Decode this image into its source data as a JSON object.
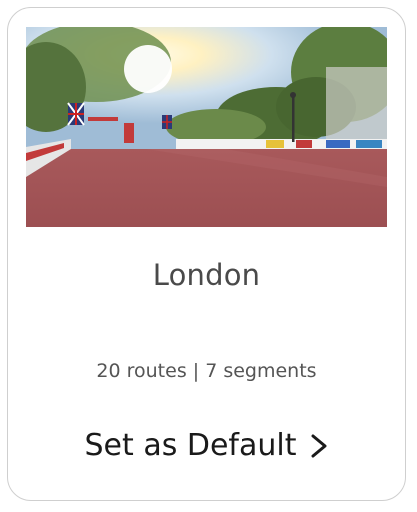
{
  "world": {
    "name": "London",
    "stats": "20 routes | 7 segments",
    "image_icon": "london-road-scene"
  },
  "action": {
    "label": "Set as Default",
    "icon": "chevron-right-icon"
  }
}
